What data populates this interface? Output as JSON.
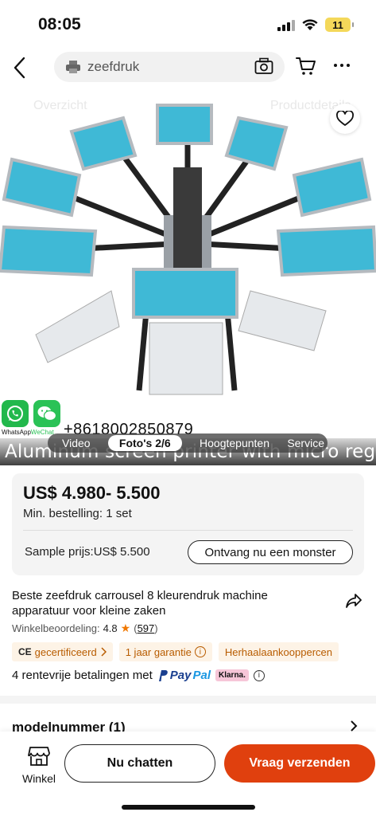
{
  "status_bar": {
    "time": "08:05",
    "battery": "11"
  },
  "nav": {
    "search_text": "zeefdruk"
  },
  "gallery": {
    "ghost_tab_left": "Overzicht",
    "ghost_tab_right": "Productdetails",
    "badge_caption_left": "WhatsApp",
    "badge_caption_mid": "WeChat",
    "badge_caption_right": "",
    "phone": "+8618002850879",
    "tabs": [
      "Video",
      "Foto's 2/6",
      "Hoogtepunten",
      "Service"
    ],
    "caption": "Aluminum screen printer with micro registration"
  },
  "price_card": {
    "price": "US$ 4.980- 5.500",
    "min_order": "Min. bestelling: 1 set",
    "sample_price": "Sample prijs:US$ 5.500",
    "sample_button": "Ontvang nu een monster"
  },
  "product": {
    "title": "Beste zeefdruk carrousel 8 kleurendruk machine apparatuur voor kleine zaken",
    "rating_label": "Winkelbeoordeling:",
    "rating_value": "4.8",
    "rating_count": "597",
    "tags": [
      "gecertificeerd",
      "1 jaar garantie",
      "Herhaalaankooppercen"
    ],
    "ce_mark": "CE",
    "payment_text": "4 rentevrije betalingen met",
    "paypal_pay": "Pay",
    "paypal_pal": "Pal",
    "klarna": "Klarna."
  },
  "model": {
    "label": "modelnummer (1)"
  },
  "bottom_bar": {
    "store_label": "Winkel",
    "chat_button": "Nu chatten",
    "inquire_button": "Vraag verzenden"
  },
  "colors": {
    "accent": "#e0400e",
    "tag_bg": "#fdf3e6",
    "tag_text": "#b85c00",
    "star": "#f07800"
  }
}
